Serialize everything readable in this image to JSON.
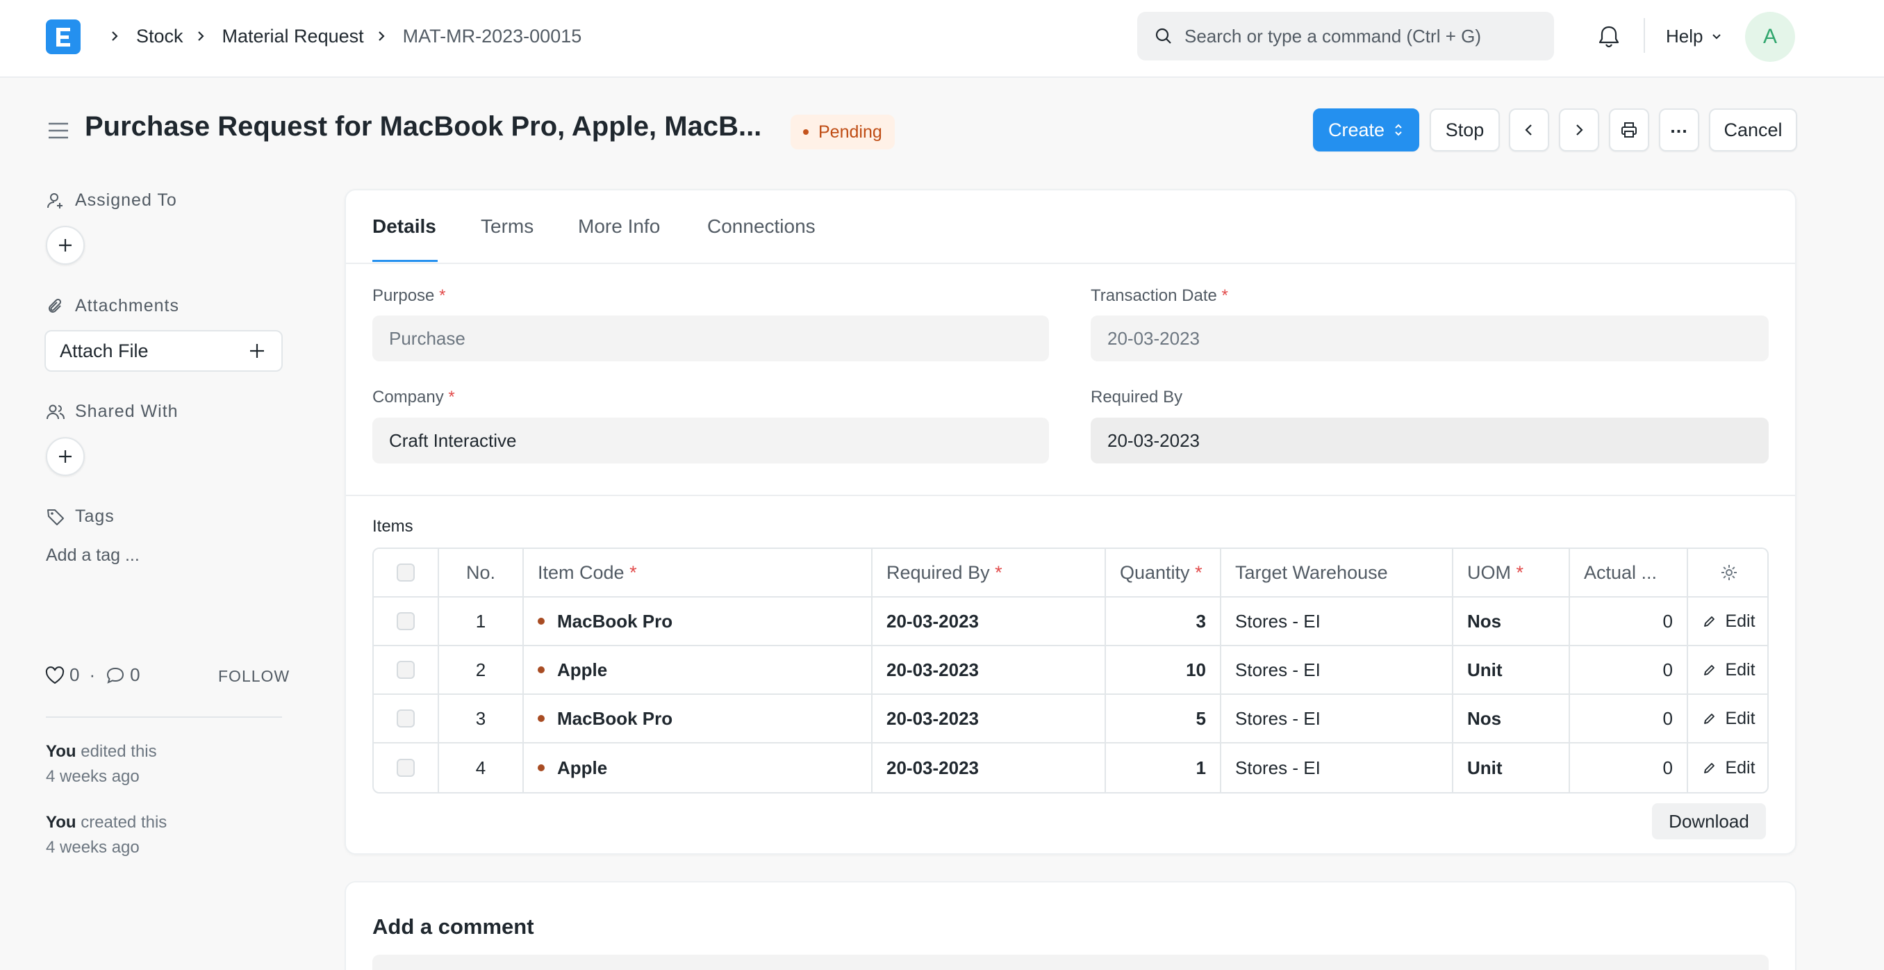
{
  "navbar": {
    "breadcrumbs": [
      "Stock",
      "Material Request",
      "MAT-MR-2023-00015"
    ],
    "search_placeholder": "Search or type a command (Ctrl + G)",
    "help_label": "Help",
    "avatar_initial": "A"
  },
  "page": {
    "title": "Purchase Request for MacBook Pro, Apple, MacB...",
    "status": "Pending",
    "buttons": {
      "create": "Create",
      "stop": "Stop",
      "more": "...",
      "cancel": "Cancel"
    }
  },
  "sidebar": {
    "assigned_to": "Assigned To",
    "attachments": "Attachments",
    "attach_file": "Attach File",
    "shared_with": "Shared With",
    "tags": "Tags",
    "add_tag": "Add a tag ...",
    "likes": "0",
    "comments": "0",
    "follow": "FOLLOW",
    "activity": [
      {
        "who": "You",
        "action": "edited this",
        "when": "4 weeks ago"
      },
      {
        "who": "You",
        "action": "created this",
        "when": "4 weeks ago"
      }
    ]
  },
  "tabs": [
    "Details",
    "Terms",
    "More Info",
    "Connections"
  ],
  "form": {
    "purpose_label": "Purpose",
    "purpose_value": "Purchase",
    "transaction_date_label": "Transaction Date",
    "transaction_date_value": "20-03-2023",
    "company_label": "Company",
    "company_value": "Craft Interactive",
    "required_by_label": "Required By",
    "required_by_value": "20-03-2023",
    "required_marker": "*"
  },
  "items": {
    "label": "Items",
    "columns": [
      "No.",
      "Item Code",
      "Required By",
      "Quantity",
      "Target Warehouse",
      "UOM",
      "Actual ..."
    ],
    "rows": [
      {
        "no": "1",
        "item_code": "MacBook Pro",
        "required_by": "20-03-2023",
        "quantity": "3",
        "warehouse": "Stores - EI",
        "uom": "Nos",
        "actual": "0",
        "edit": "Edit"
      },
      {
        "no": "2",
        "item_code": "Apple",
        "required_by": "20-03-2023",
        "quantity": "10",
        "warehouse": "Stores - EI",
        "uom": "Unit",
        "actual": "0",
        "edit": "Edit"
      },
      {
        "no": "3",
        "item_code": "MacBook Pro",
        "required_by": "20-03-2023",
        "quantity": "5",
        "warehouse": "Stores - EI",
        "uom": "Nos",
        "actual": "0",
        "edit": "Edit"
      },
      {
        "no": "4",
        "item_code": "Apple",
        "required_by": "20-03-2023",
        "quantity": "1",
        "warehouse": "Stores - EI",
        "uom": "Unit",
        "actual": "0",
        "edit": "Edit"
      }
    ],
    "download": "Download"
  },
  "comment": {
    "title": "Add a comment"
  },
  "colors": {
    "primary": "#2490ef",
    "pending_bg": "#fff1e7",
    "pending_text": "#bf4c14",
    "required": "#e24c4c"
  }
}
